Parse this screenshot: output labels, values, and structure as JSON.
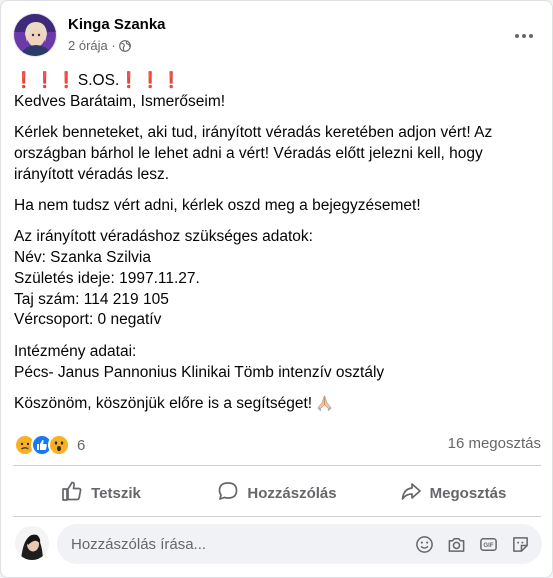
{
  "post": {
    "author": "Kinga Szanka",
    "time": "2 órája ·",
    "headline_excl_left": "❗❗❗",
    "headline_text": "S.OS.",
    "headline_excl_right": "❗❗❗",
    "paragraphs": [
      "Kedves Barátaim, Ismerőseim!",
      "Kérlek benneteket, aki tud, irányított véradás keretében adjon vért! Az országban bárhol le lehet adni a vért! Véradás előtt jelezni kell, hogy irányított véradás lesz.",
      "Ha nem tudsz vért adni, kérlek oszd meg a bejegyzésemet!",
      "Az irányított véradáshoz szükséges adatok:",
      "Név: Szanka Szilvia",
      "Születés ideje: 1997.11.27.",
      "Taj szám: 114 219 105",
      "Vércsoport: 0 negatív",
      "Intézmény adatai:",
      "Pécs- Janus Pannonius Klinikai Tömb intenzív osztály",
      "Köszönöm, köszönjük előre is a segítséget!"
    ]
  },
  "stats": {
    "reaction_count": "6",
    "shares": "16 megosztás"
  },
  "actions": {
    "like": "Tetszik",
    "comment": "Hozzászólás",
    "share": "Megosztás"
  },
  "comment": {
    "placeholder": "Hozzászólás írása..."
  },
  "colors": {
    "accent": "#1877f2",
    "text_secondary": "#65676b",
    "excl_red": "#e5202a"
  }
}
